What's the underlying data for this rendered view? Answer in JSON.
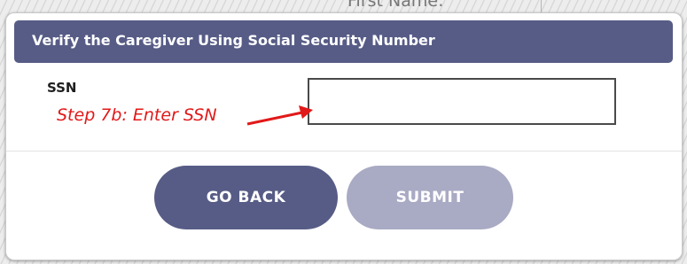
{
  "background": {
    "field_label": "First Name:"
  },
  "modal": {
    "title": "Verify the Caregiver Using Social Security Number",
    "ssn_label": "SSN",
    "ssn_value": "",
    "buttons": {
      "back_label": "GO BACK",
      "submit_label": "SUBMIT"
    }
  },
  "annotation": {
    "text": "Step 7b: Enter SSN",
    "icon": "arrow-right-icon"
  },
  "colors": {
    "header": "#575c86",
    "primary_button": "#575c86",
    "disabled_button": "#a9aac3",
    "annotation": "#e11919"
  }
}
